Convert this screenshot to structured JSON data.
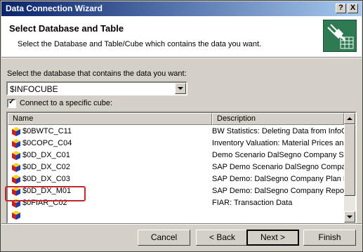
{
  "window": {
    "title": "Data Connection Wizard",
    "help_glyph": "?",
    "close_glyph": "X"
  },
  "header": {
    "title": "Select Database and Table",
    "subtitle": "Select the Database and Table/Cube which contains the data you want."
  },
  "database": {
    "label": "Select the database that contains the data you want:",
    "selected": "$INFOCUBE"
  },
  "connect_cube": {
    "label": "Connect to a specific cube:",
    "checked": true,
    "check_glyph": "✓"
  },
  "table": {
    "columns": [
      "Name",
      "Description"
    ],
    "rows": [
      {
        "name": "$0BWTC_C11",
        "description": "BW Statistics: Deleting Data from InfoC"
      },
      {
        "name": "$0COPC_C04",
        "description": "Inventory Valuation: Material Prices and"
      },
      {
        "name": "$0D_DX_C01",
        "description": "Demo Scenario DalSegno Company Sale"
      },
      {
        "name": "$0D_DX_C02",
        "description": "SAP Demo Scenario DalSegno Company"
      },
      {
        "name": "$0D_DX_C03",
        "description": "SAP Demo: DalSegno Company Plan Da"
      },
      {
        "name": "$0D_DX_M01",
        "description": "SAP Demo: DalSegno Company Reportin"
      },
      {
        "name": "$0FIAR_C02",
        "description": "FIAR: Transaction Data"
      },
      {
        "name": "",
        "description": ""
      }
    ],
    "highlighted_row": "$0D_DX_M01"
  },
  "buttons": {
    "cancel": "Cancel",
    "back": "< Back",
    "next": "Next >",
    "finish": "Finish"
  },
  "colors": {
    "title_bar_start": "#0a246a",
    "title_bar_end": "#a6caf0",
    "highlight_border": "#c0282d",
    "face": "#d4d0c8"
  }
}
